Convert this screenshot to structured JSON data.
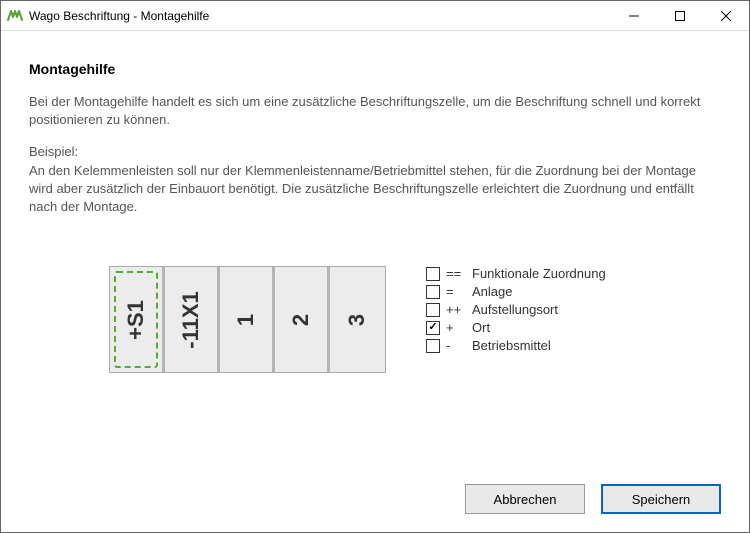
{
  "titlebar": {
    "title": "Wago Beschriftung - Montagehilfe"
  },
  "content": {
    "heading": "Montagehilfe",
    "paragraph1": "Bei der Montagehilfe handelt es sich um eine zusätzliche Beschriftungszelle, um die Beschriftung schnell und korrekt positionieren zu können.",
    "paragraph2_line1": "Beispiel:",
    "paragraph2_rest": "An den Kelemmenleisten soll nur der Klemmenleistenname/Betriebmittel stehen, für die Zuordnung bei der Montage wird aber zusätzlich der Einbauort benötigt. Die zusätzliche Beschriftungszelle erleichtert die Zuordnung und entfällt nach der Montage."
  },
  "strip": {
    "cells": [
      "+S1",
      "-11X1",
      "1",
      "2",
      "3"
    ]
  },
  "checks": [
    {
      "symbol": "==",
      "label": "Funktionale Zuordnung",
      "checked": false
    },
    {
      "symbol": "=",
      "label": "Anlage",
      "checked": false
    },
    {
      "symbol": "++",
      "label": "Aufstellungsort",
      "checked": false
    },
    {
      "symbol": "+",
      "label": "Ort",
      "checked": true
    },
    {
      "symbol": "-",
      "label": "Betriebsmittel",
      "checked": false
    }
  ],
  "buttons": {
    "cancel": "Abbrechen",
    "save": "Speichern"
  }
}
